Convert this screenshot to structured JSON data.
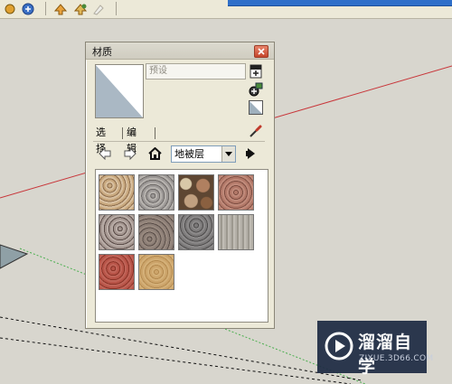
{
  "panel": {
    "title": "材质",
    "material_name_placeholder": "预设",
    "tabs": [
      {
        "label": "选择"
      },
      {
        "label": "编辑"
      }
    ],
    "category": {
      "selected": "地被层"
    },
    "swatches": [
      {
        "name": "tan-gravel",
        "color": "#b49470"
      },
      {
        "name": "gray-gravel",
        "color": "#8e8a88"
      },
      {
        "name": "river-pebbles",
        "color": "#9a7456"
      },
      {
        "name": "red-gravel",
        "color": "#a06a5a"
      },
      {
        "name": "mixed-gravel",
        "color": "#8e8480"
      },
      {
        "name": "dark-gravel",
        "color": "#7c706a"
      },
      {
        "name": "charcoal-gravel",
        "color": "#6c6a6a"
      },
      {
        "name": "light-gray-ground",
        "color": "#aaa69e"
      },
      {
        "name": "red-ground",
        "color": "#a84a3e"
      },
      {
        "name": "sand",
        "color": "#c49c60"
      }
    ]
  },
  "watermark": {
    "brand": "溜溜自学",
    "url": "ZIXUE.3D66.COM"
  },
  "colors": {
    "red_axis": "#c8363a",
    "green_axis": "#4caf50",
    "toolbar_bg": "#ece9d8",
    "viewport_bg": "#d8d6ce"
  }
}
